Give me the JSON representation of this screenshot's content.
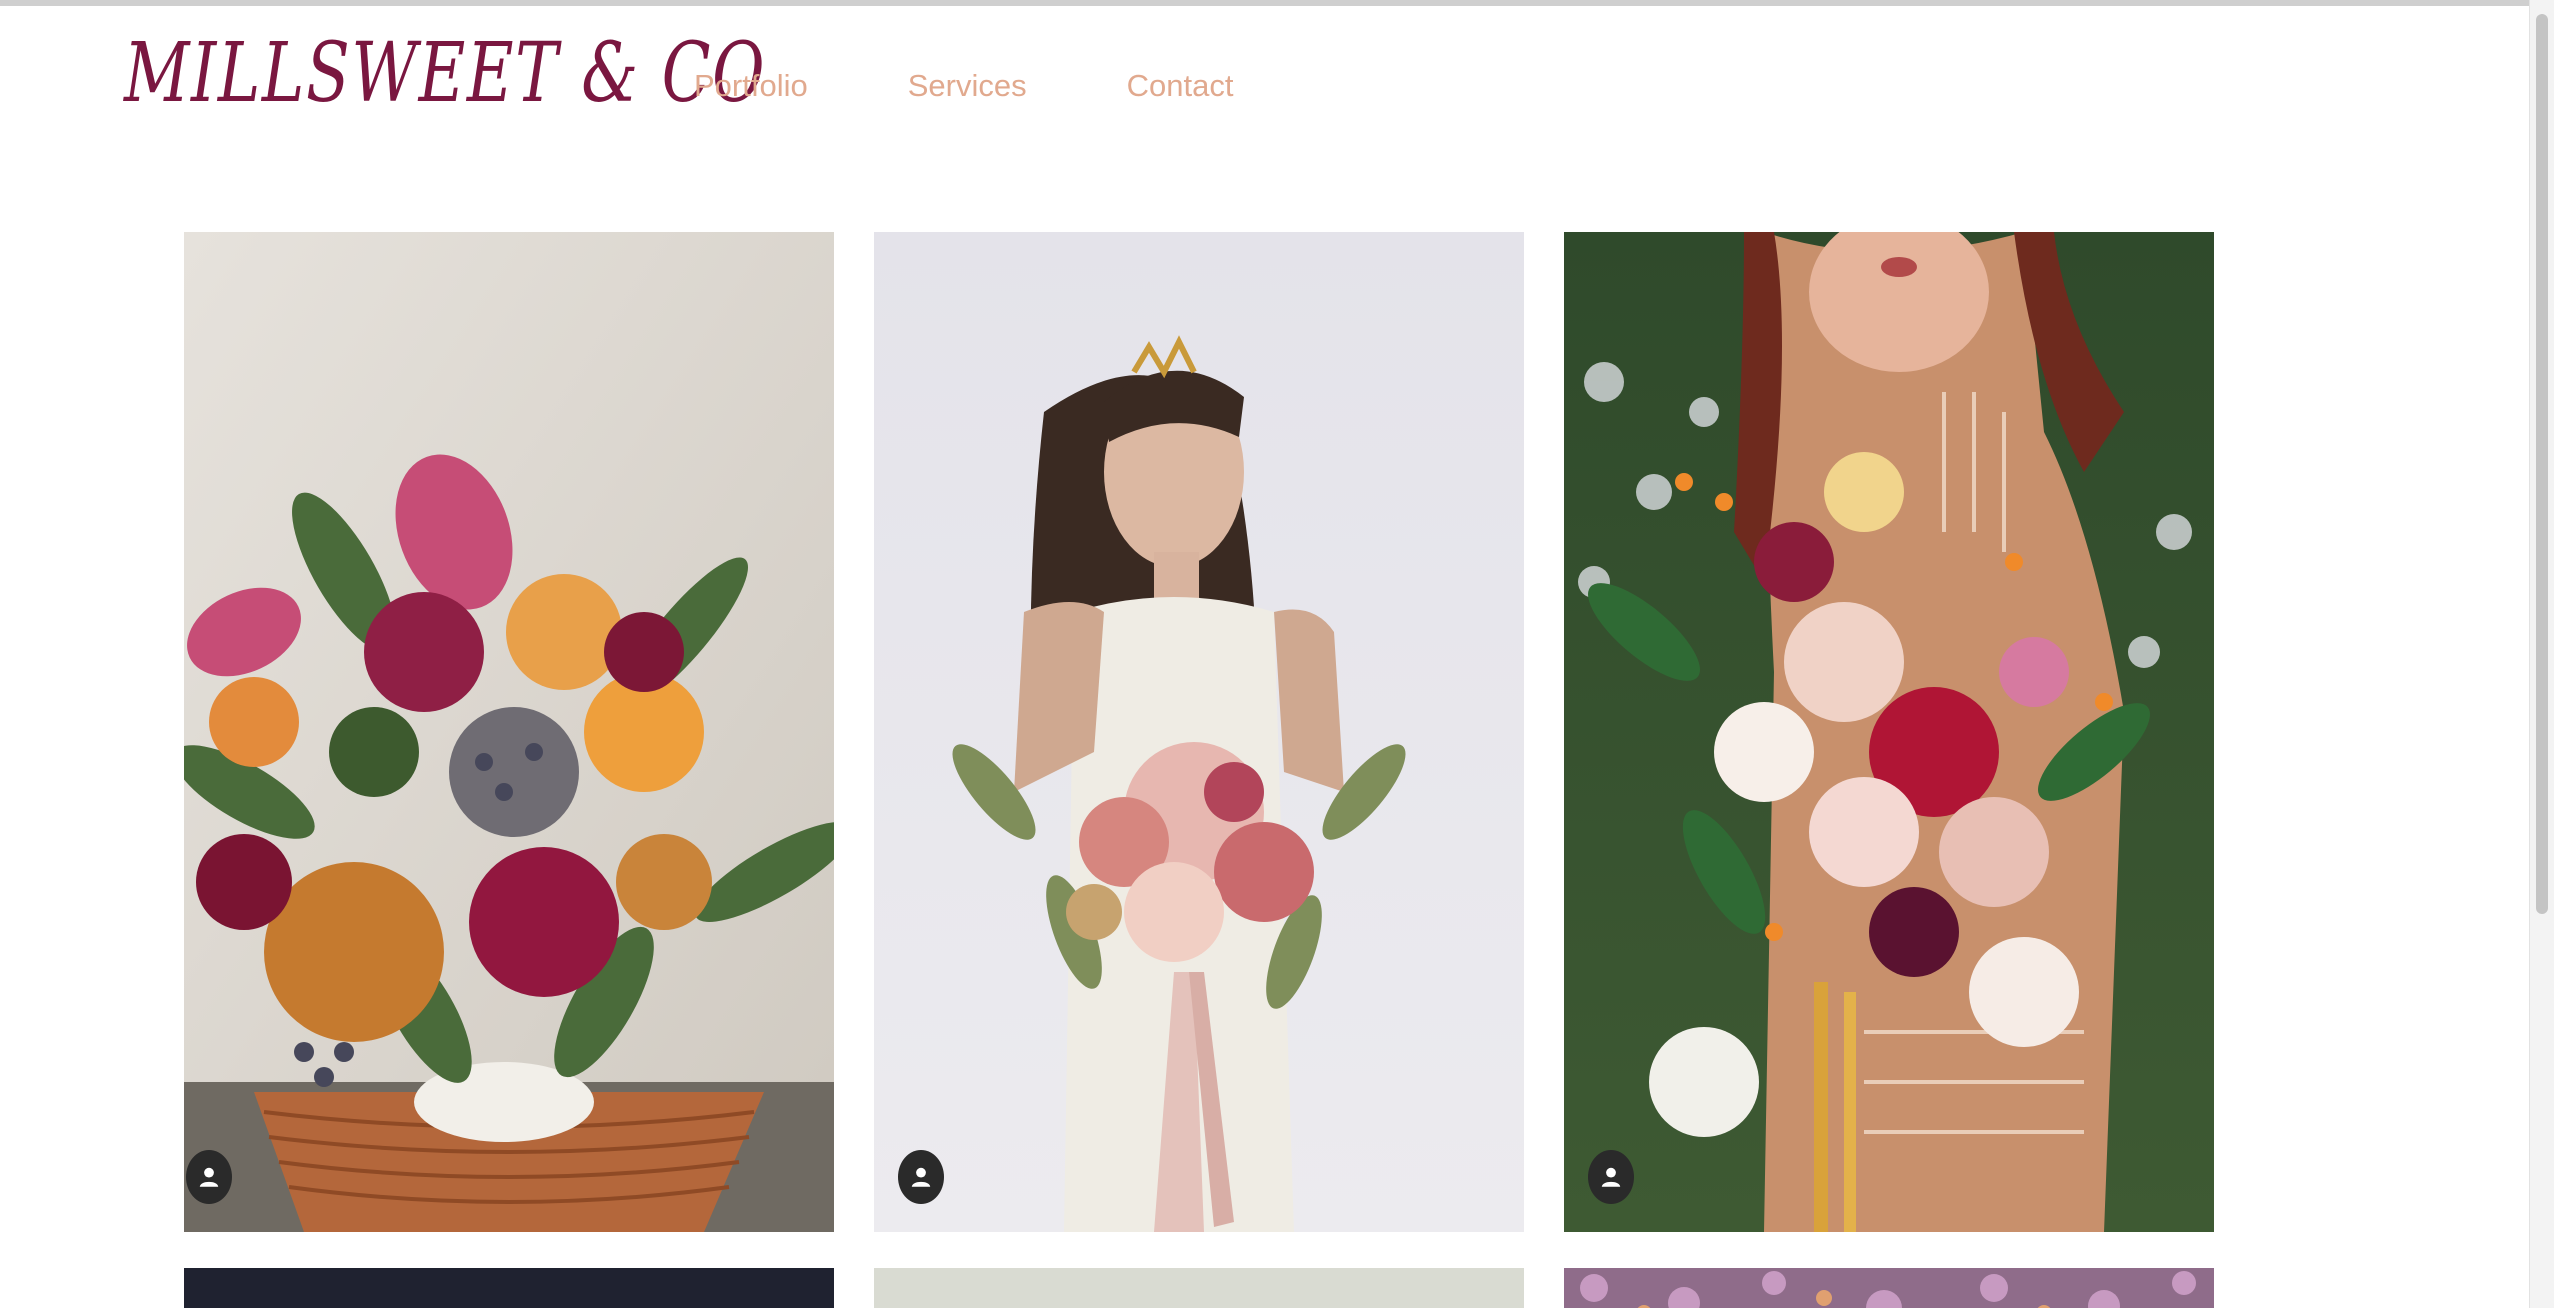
{
  "brand": {
    "logo_text": "MILLSWEET & CO",
    "logo_color": "#7a1740"
  },
  "nav": {
    "items": [
      {
        "label": "Portfolio"
      },
      {
        "label": "Services"
      },
      {
        "label": "Contact"
      }
    ],
    "link_color": "#e1a98e"
  },
  "gallery": {
    "tiles": [
      {
        "subject": "bouquet in woven basket",
        "icon": "user-avatar-icon"
      },
      {
        "subject": "bride holding bouquet",
        "icon": "user-avatar-icon"
      },
      {
        "subject": "woman holding large bouquet",
        "icon": "user-avatar-icon"
      }
    ]
  }
}
